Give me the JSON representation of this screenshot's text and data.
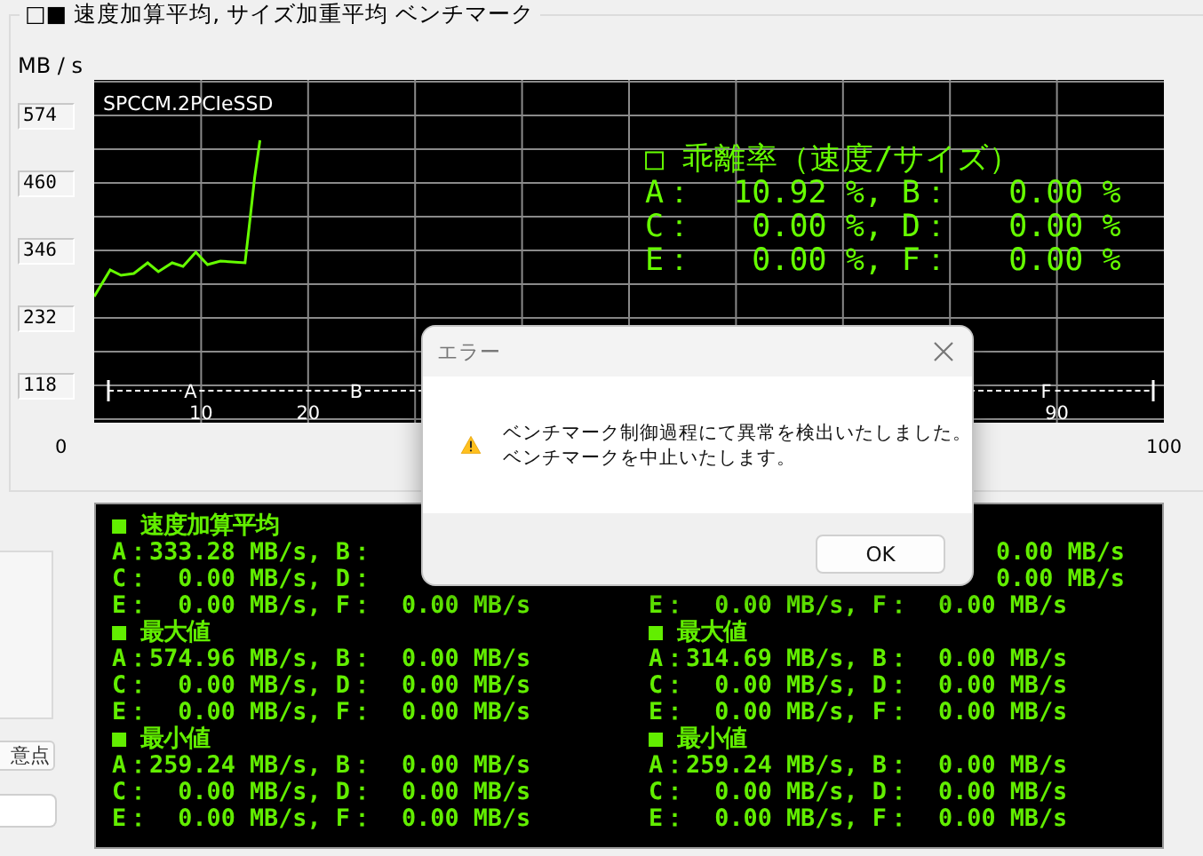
{
  "group": {
    "title": "□■ 速度加算平均, サイズ加重平均 ベンチマーク"
  },
  "chart": {
    "chart_data": {
      "type": "line",
      "ylabel": "MB / s",
      "xlim": [
        0,
        100
      ],
      "ylim": [
        55,
        634
      ],
      "xticks": [
        10,
        20,
        90
      ],
      "yticks": [
        118,
        232,
        346,
        460,
        574
      ],
      "grid": true,
      "series": [
        {
          "name": "SPCCM.2PCIeSSD",
          "color": "#66ff00",
          "values": [
            268,
            313,
            304,
            307,
            325,
            310,
            325,
            319,
            343,
            322,
            328,
            325,
            388,
            469,
            532
          ]
        }
      ],
      "x": [
        0,
        1.5,
        2.5,
        3.7,
        5,
        6,
        7.3,
        8.3,
        9.5,
        10.6,
        11.8,
        14.1,
        14.5,
        15,
        15.5
      ],
      "annotations": [
        "A",
        "B",
        "F"
      ]
    },
    "range_labels": [
      "0",
      "100"
    ]
  },
  "deviation": {
    "title": "□ 乖離率（速度/サイズ）",
    "rows": [
      "A：  10.92 %, B：   0.00 %",
      "C：   0.00 %, D：   0.00 %",
      "E：   0.00 %, F：   0.00 %"
    ]
  },
  "results": [
    {
      "sections": [
        {
          "title": "■ 速度加算平均",
          "rows": [
            {
              "kind": "full",
              "text": "A：333.28 MB/s, B："
            },
            {
              "kind": "full",
              "text": "C：  0.00 MB/s, D："
            },
            {
              "kind": "full",
              "text": "E：  0.00 MB/s, F：  0.00 MB/s"
            }
          ]
        },
        {
          "title": "■ 最大値",
          "rows": [
            {
              "kind": "full",
              "text": "A：574.96 MB/s, B：  0.00 MB/s"
            },
            {
              "kind": "full",
              "text": "C：  0.00 MB/s, D：  0.00 MB/s"
            },
            {
              "kind": "full",
              "text": "E：  0.00 MB/s, F：  0.00 MB/s"
            }
          ]
        },
        {
          "title": "■ 最小値",
          "rows": [
            {
              "kind": "full",
              "text": "A：259.24 MB/s, B：  0.00 MB/s"
            },
            {
              "kind": "full",
              "text": "C：  0.00 MB/s, D：  0.00 MB/s"
            },
            {
              "kind": "full",
              "text": "E：  0.00 MB/s, F：  0.00 MB/s"
            }
          ]
        }
      ]
    },
    {
      "sections": [
        {
          "rows": [
            {
              "kind": "tail",
              "text": "0.00 MB/s"
            },
            {
              "kind": "tail",
              "text": "0.00 MB/s"
            },
            {
              "kind": "full",
              "text": "E：  0.00 MB/s, F：  0.00 MB/s"
            }
          ]
        },
        {
          "title": "■ 最大値",
          "rows": [
            {
              "kind": "full",
              "text": "A：314.69 MB/s, B：  0.00 MB/s"
            },
            {
              "kind": "full",
              "text": "C：  0.00 MB/s, D：  0.00 MB/s"
            },
            {
              "kind": "full",
              "text": "E：  0.00 MB/s, F：  0.00 MB/s"
            }
          ]
        },
        {
          "title": "■ 最小値",
          "rows": [
            {
              "kind": "full",
              "text": "A：259.24 MB/s, B：  0.00 MB/s"
            },
            {
              "kind": "full",
              "text": "C：  0.00 MB/s, D：  0.00 MB/s"
            },
            {
              "kind": "full",
              "text": "E：  0.00 MB/s, F：  0.00 MB/s"
            }
          ]
        }
      ]
    }
  ],
  "left_panel": {
    "button": "意点"
  },
  "dialog": {
    "title": "エラー",
    "message": [
      "ベンチマーク制御過程にて異常を検出いたしました。",
      "ベンチマークを中止いたします。"
    ],
    "button": "OK"
  }
}
